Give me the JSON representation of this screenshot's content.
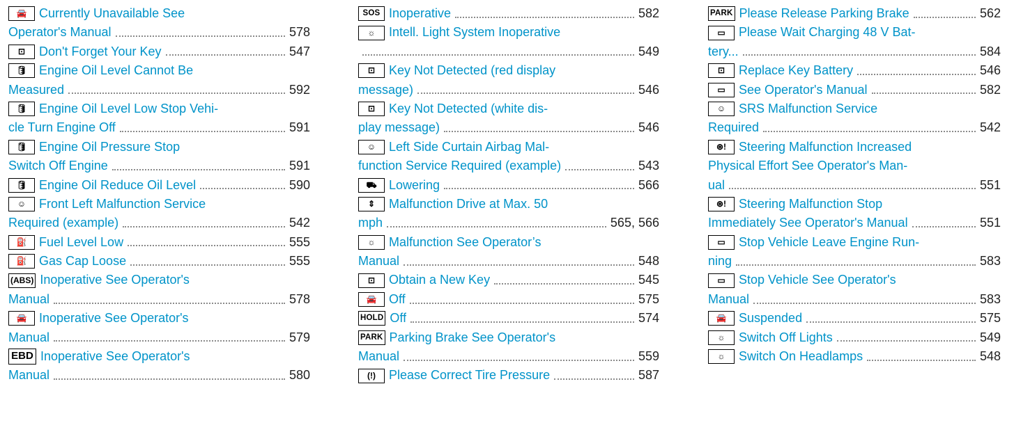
{
  "columns": [
    [
      {
        "icon": "car-skid-icon",
        "glyph": "🚘",
        "lines": [
          "Currently Unavailable See",
          "Operator's Manual"
        ],
        "page": "578"
      },
      {
        "icon": "key-icon",
        "glyph": "⊡",
        "lines": [
          "Don't Forget Your Key"
        ],
        "page": "547"
      },
      {
        "icon": "oil-can-icon",
        "glyph": "🛢",
        "lines": [
          "Engine Oil Level Cannot Be",
          "Measured"
        ],
        "page": "592"
      },
      {
        "icon": "oil-can-icon",
        "glyph": "🛢",
        "lines": [
          "Engine Oil Level Low Stop Vehi-",
          "cle Turn Engine Off"
        ],
        "page": "591"
      },
      {
        "icon": "oil-can-icon",
        "glyph": "🛢",
        "lines": [
          "Engine Oil Pressure Stop",
          "Switch Off Engine"
        ],
        "page": "591"
      },
      {
        "icon": "oil-can-icon",
        "glyph": "🛢",
        "lines": [
          "Engine Oil Reduce Oil Level"
        ],
        "page": "590"
      },
      {
        "icon": "airbag-icon",
        "glyph": "☺",
        "lines": [
          "Front Left Malfunction Service",
          "Required (example)"
        ],
        "page": "542"
      },
      {
        "icon": "fuel-pump-icon",
        "glyph": "⛽",
        "lines": [
          "Fuel Level Low"
        ],
        "page": "555"
      },
      {
        "icon": "fuel-pump-icon",
        "glyph": "⛽",
        "lines": [
          "Gas Cap Loose"
        ],
        "page": "555"
      },
      {
        "icon": "abs-icon",
        "glyph": "(ABS)",
        "lines": [
          "Inoperative See Operator's",
          "Manual"
        ],
        "page": "578"
      },
      {
        "icon": "car-skid-icon",
        "glyph": "🚘",
        "lines": [
          "Inoperative See Operator's",
          "Manual"
        ],
        "page": "579"
      },
      {
        "icon": "ebd-icon",
        "glyph": "EBD",
        "lines": [
          "Inoperative See Operator's",
          "Manual"
        ],
        "page": "580"
      }
    ],
    [
      {
        "icon": "sos-icon",
        "glyph": "SOS",
        "lines": [
          "Inoperative"
        ],
        "page": "582"
      },
      {
        "icon": "light-bulb-icon",
        "glyph": "☼",
        "lines": [
          "Intell. Light System Inoperative",
          ""
        ],
        "page": "549"
      },
      {
        "icon": "key-icon",
        "glyph": "⊡",
        "lines": [
          "Key Not Detected  (red display",
          "message)"
        ],
        "page": "546"
      },
      {
        "icon": "key-icon",
        "glyph": "⊡",
        "lines": [
          "Key Not Detected  (white dis-",
          "play message)"
        ],
        "page": "546"
      },
      {
        "icon": "airbag-icon",
        "glyph": "☺",
        "lines": [
          "Left Side Curtain Airbag Mal-",
          "function Service Required (example)"
        ],
        "page": "543"
      },
      {
        "icon": "car-lowering-icon",
        "glyph": "⛟",
        "lines": [
          "Lowering"
        ],
        "page": "566"
      },
      {
        "icon": "suspension-icon",
        "glyph": "⇕",
        "lines": [
          "Malfunction Drive at Max. 50",
          "mph"
        ],
        "page": "565, 566"
      },
      {
        "icon": "light-bulb-icon",
        "glyph": "☼",
        "lines": [
          "Malfunction See Operator’s",
          "Manual"
        ],
        "page": "548"
      },
      {
        "icon": "key-icon",
        "glyph": "⊡",
        "lines": [
          "Obtain a New Key"
        ],
        "page": "545"
      },
      {
        "icon": "cruise-assist-icon",
        "glyph": "🚘",
        "lines": [
          "Off"
        ],
        "page": "575"
      },
      {
        "icon": "hold-icon",
        "glyph": "HOLD",
        "lines": [
          "Off"
        ],
        "page": "574"
      },
      {
        "icon": "park-icon",
        "glyph": "PARK",
        "lines": [
          "Parking Brake See Operator's",
          "Manual"
        ],
        "page": "559"
      },
      {
        "icon": "tire-pressure-icon",
        "glyph": "(!)",
        "lines": [
          "Please Correct Tire Pressure"
        ],
        "page": "587"
      }
    ],
    [
      {
        "icon": "park-icon",
        "glyph": "PARK",
        "lines": [
          "Please Release Parking Brake"
        ],
        "page": "562"
      },
      {
        "icon": "battery-icon",
        "glyph": "▭",
        "lines": [
          "Please Wait Charging 48 V Bat-",
          "tery..."
        ],
        "page": "584"
      },
      {
        "icon": "key-icon",
        "glyph": "⊡",
        "lines": [
          "Replace Key Battery"
        ],
        "page": "546"
      },
      {
        "icon": "battery-icon",
        "glyph": "▭",
        "lines": [
          "See Operator's Manual"
        ],
        "page": "582"
      },
      {
        "icon": "airbag-icon",
        "glyph": "☺",
        "lines": [
          "SRS Malfunction Service",
          "Required"
        ],
        "page": "542"
      },
      {
        "icon": "steering-wheel-icon",
        "glyph": "⊛!",
        "lines": [
          "Steering Malfunction Increased",
          "Physical Effort See Operator's Man-",
          "ual"
        ],
        "page": "551"
      },
      {
        "icon": "steering-wheel-icon",
        "glyph": "⊛!",
        "lines": [
          "Steering Malfunction Stop",
          "Immediately See Operator's Manual"
        ],
        "page": "551"
      },
      {
        "icon": "battery-icon",
        "glyph": "▭",
        "lines": [
          "Stop Vehicle Leave Engine Run-",
          "ning"
        ],
        "page": "583"
      },
      {
        "icon": "battery-icon",
        "glyph": "▭",
        "lines": [
          "Stop Vehicle See Operator's",
          "Manual"
        ],
        "page": "583"
      },
      {
        "icon": "cruise-assist-icon",
        "glyph": "🚘",
        "lines": [
          "Suspended"
        ],
        "page": "575"
      },
      {
        "icon": "light-bulb-icon",
        "glyph": "☼",
        "lines": [
          "Switch Off Lights"
        ],
        "page": "549"
      },
      {
        "icon": "light-bulb-icon",
        "glyph": "☼",
        "lines": [
          "Switch On Headlamps"
        ],
        "page": "548"
      }
    ]
  ]
}
